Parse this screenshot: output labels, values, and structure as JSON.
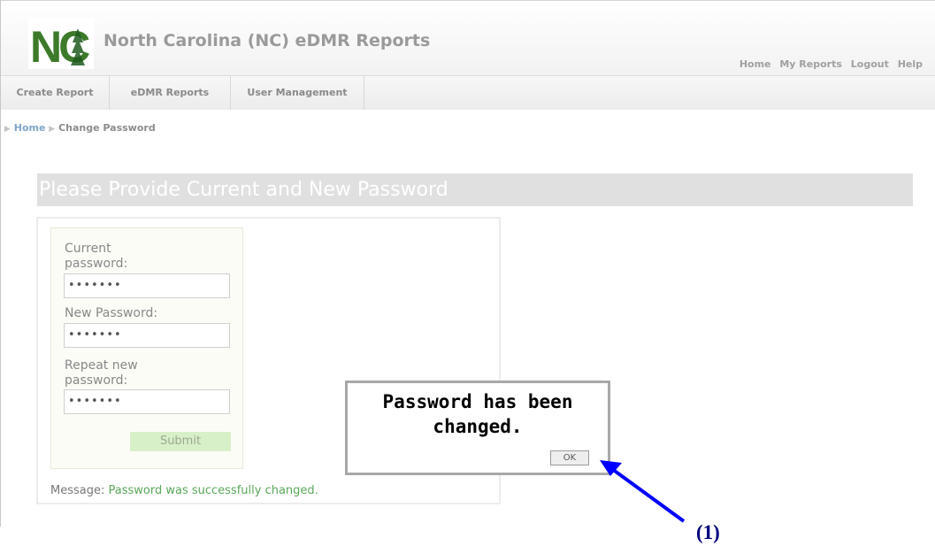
{
  "header": {
    "title": "North Carolina (NC) eDMR Reports",
    "logo_text": "NC",
    "links": [
      "Home",
      "My Reports",
      "Logout",
      "Help"
    ]
  },
  "nav": {
    "tabs": [
      "Create Report",
      "eDMR Reports",
      "User Management"
    ]
  },
  "breadcrumb": {
    "home": "Home",
    "current": "Change Password"
  },
  "page": {
    "heading": "Please Provide Current and New Password"
  },
  "form": {
    "current_label": "Current password:",
    "current_value": "•••••••",
    "new_label": "New Password:",
    "new_value": "•••••••",
    "repeat_label": "Repeat new password:",
    "repeat_value": "•••••••",
    "submit_label": "Submit",
    "message_label": "Message:",
    "message_text": "Password was successfully changed."
  },
  "dialog": {
    "text": "Password has been changed.",
    "ok_label": "OK"
  },
  "annotation": {
    "label": "(1)",
    "color": "#0000ff"
  },
  "colors": {
    "logo_green": "#2e6b2e",
    "success_green": "#5ba85b",
    "link_blue": "#7fa6c8"
  }
}
